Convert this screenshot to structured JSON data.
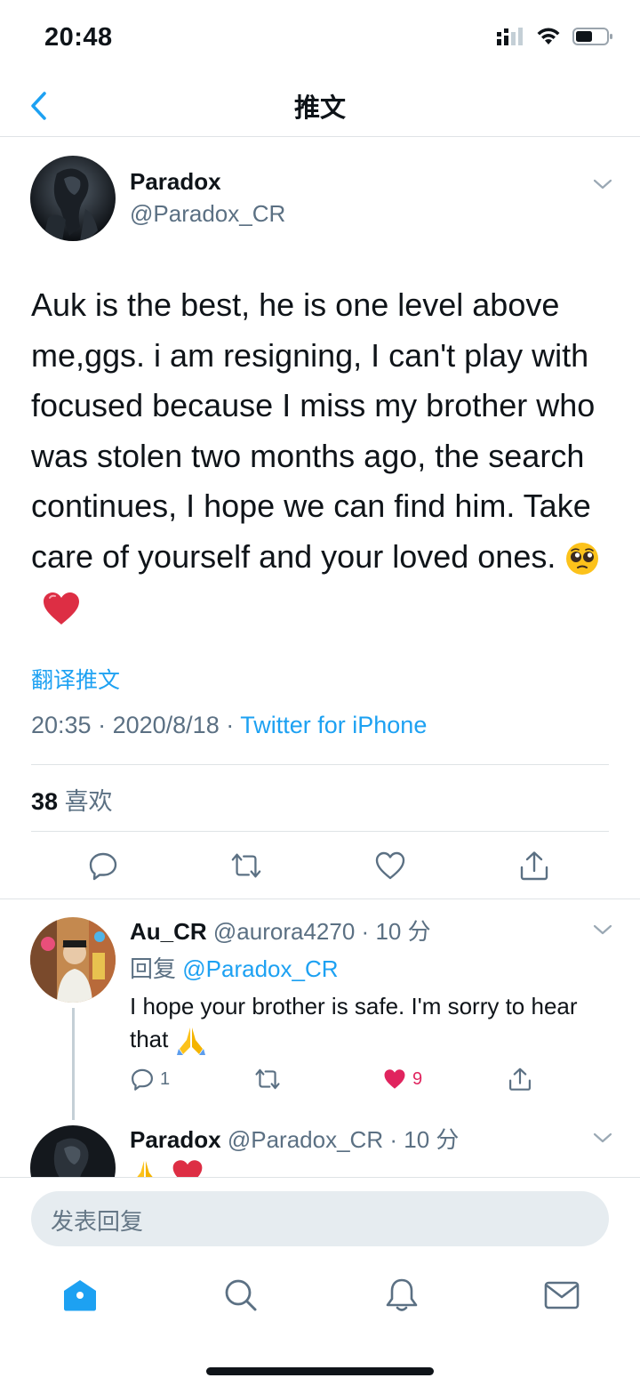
{
  "status_bar": {
    "time": "20:48"
  },
  "nav": {
    "title": "推文"
  },
  "tweet": {
    "display_name": "Paradox",
    "handle": "@Paradox_CR",
    "text": "Auk is the best, he is one level above me,ggs. i am resigning, I can't play with focused because I miss my brother who was stolen two months ago, the search continues, I hope we can find him. Take care of yourself and your loved ones.",
    "translate_label": "翻译推文",
    "time": "20:35",
    "date": "2020/8/18",
    "source": "Twitter for iPhone",
    "likes_count": "38",
    "likes_label": "喜欢"
  },
  "replies": [
    {
      "display_name": "Au_CR",
      "handle": "@aurora4270",
      "time_ago": "10 分",
      "reply_label": "回复",
      "reply_to": "@Paradox_CR",
      "text": "I hope your brother is safe. I'm sorry to hear that",
      "reply_count": "1",
      "like_count": "9"
    },
    {
      "display_name": "Paradox",
      "handle": "@Paradox_CR",
      "time_ago": "10 分"
    }
  ],
  "compose": {
    "placeholder": "发表回复"
  },
  "colors": {
    "accent": "#1da1f2",
    "like": "#e0245e",
    "muted": "#5b7083"
  },
  "icons": [
    "back-chevron-icon",
    "reply-icon",
    "retweet-icon",
    "like-icon",
    "share-icon",
    "home-icon",
    "search-icon",
    "notifications-icon",
    "messages-icon"
  ]
}
